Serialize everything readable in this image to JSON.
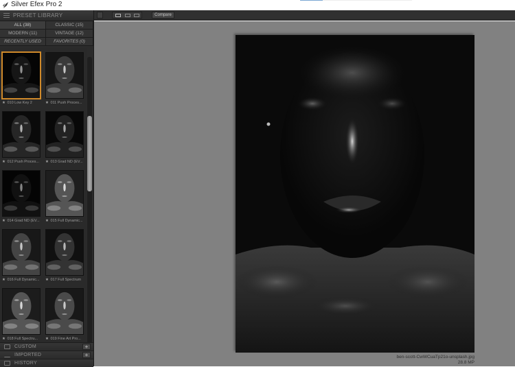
{
  "window": {
    "title": "Silver Efex Pro 2",
    "progress_fraction": 0.2
  },
  "preset_library": {
    "header": "PRESET LIBRARY",
    "categories": [
      {
        "label": "ALL (38)",
        "active": true
      },
      {
        "label": "CLASSIC (15)",
        "active": false
      },
      {
        "label": "MODERN (11)",
        "active": false
      },
      {
        "label": "VINTAGE (12)",
        "active": false
      },
      {
        "label": "RECENTLY USED",
        "active": false
      },
      {
        "label": "FAVORITES (0)",
        "active": false
      }
    ],
    "presets": [
      {
        "label": "010 Low Key 2",
        "selected": true
      },
      {
        "label": "011 Push Proces...",
        "selected": false
      },
      {
        "label": "012 Push Proces...",
        "selected": false
      },
      {
        "label": "013 Grad ND (EV...",
        "selected": false
      },
      {
        "label": "014 Grad ND (EV...",
        "selected": false
      },
      {
        "label": "015 Full Dynamic...",
        "selected": false
      },
      {
        "label": "016 Full Dynamic...",
        "selected": false
      },
      {
        "label": "017 Full Spectrum",
        "selected": false
      },
      {
        "label": "018 Full Spectru...",
        "selected": false
      },
      {
        "label": "019 Fine Art Pro...",
        "selected": false
      }
    ],
    "scroll_position_fraction": 0.27
  },
  "sections": {
    "custom": "CUSTOM",
    "imported": "IMPORTED",
    "history": "HISTORY",
    "add_symbol": "+"
  },
  "toolbar": {
    "compare_label": "Compare"
  },
  "preview": {
    "filename": "ben-scott-CwWCuaTp21o-unsplash.jpg",
    "size": "28.8 MP"
  },
  "colors": {
    "selection_accent": "#d08a2a",
    "canvas_bg": "#818181",
    "panel_bg": "#2b2b2b"
  }
}
